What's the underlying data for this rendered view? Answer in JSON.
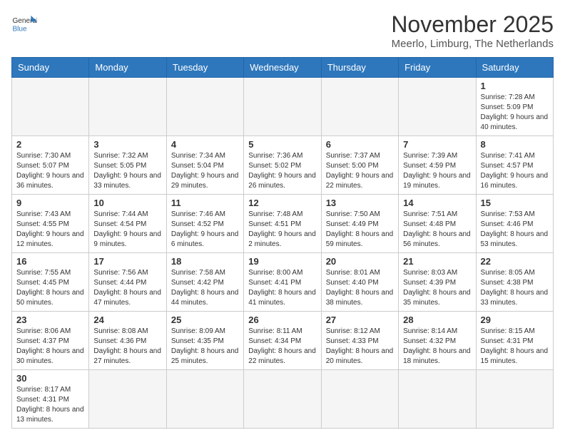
{
  "logo": {
    "text_general": "General",
    "text_blue": "Blue"
  },
  "title": "November 2025",
  "location": "Meerlo, Limburg, The Netherlands",
  "days_of_week": [
    "Sunday",
    "Monday",
    "Tuesday",
    "Wednesday",
    "Thursday",
    "Friday",
    "Saturday"
  ],
  "weeks": [
    [
      {
        "day": null,
        "info": null
      },
      {
        "day": null,
        "info": null
      },
      {
        "day": null,
        "info": null
      },
      {
        "day": null,
        "info": null
      },
      {
        "day": null,
        "info": null
      },
      {
        "day": null,
        "info": null
      },
      {
        "day": "1",
        "info": "Sunrise: 7:28 AM\nSunset: 5:09 PM\nDaylight: 9 hours and 40 minutes."
      }
    ],
    [
      {
        "day": "2",
        "info": "Sunrise: 7:30 AM\nSunset: 5:07 PM\nDaylight: 9 hours and 36 minutes."
      },
      {
        "day": "3",
        "info": "Sunrise: 7:32 AM\nSunset: 5:05 PM\nDaylight: 9 hours and 33 minutes."
      },
      {
        "day": "4",
        "info": "Sunrise: 7:34 AM\nSunset: 5:04 PM\nDaylight: 9 hours and 29 minutes."
      },
      {
        "day": "5",
        "info": "Sunrise: 7:36 AM\nSunset: 5:02 PM\nDaylight: 9 hours and 26 minutes."
      },
      {
        "day": "6",
        "info": "Sunrise: 7:37 AM\nSunset: 5:00 PM\nDaylight: 9 hours and 22 minutes."
      },
      {
        "day": "7",
        "info": "Sunrise: 7:39 AM\nSunset: 4:59 PM\nDaylight: 9 hours and 19 minutes."
      },
      {
        "day": "8",
        "info": "Sunrise: 7:41 AM\nSunset: 4:57 PM\nDaylight: 9 hours and 16 minutes."
      }
    ],
    [
      {
        "day": "9",
        "info": "Sunrise: 7:43 AM\nSunset: 4:55 PM\nDaylight: 9 hours and 12 minutes."
      },
      {
        "day": "10",
        "info": "Sunrise: 7:44 AM\nSunset: 4:54 PM\nDaylight: 9 hours and 9 minutes."
      },
      {
        "day": "11",
        "info": "Sunrise: 7:46 AM\nSunset: 4:52 PM\nDaylight: 9 hours and 6 minutes."
      },
      {
        "day": "12",
        "info": "Sunrise: 7:48 AM\nSunset: 4:51 PM\nDaylight: 9 hours and 2 minutes."
      },
      {
        "day": "13",
        "info": "Sunrise: 7:50 AM\nSunset: 4:49 PM\nDaylight: 8 hours and 59 minutes."
      },
      {
        "day": "14",
        "info": "Sunrise: 7:51 AM\nSunset: 4:48 PM\nDaylight: 8 hours and 56 minutes."
      },
      {
        "day": "15",
        "info": "Sunrise: 7:53 AM\nSunset: 4:46 PM\nDaylight: 8 hours and 53 minutes."
      }
    ],
    [
      {
        "day": "16",
        "info": "Sunrise: 7:55 AM\nSunset: 4:45 PM\nDaylight: 8 hours and 50 minutes."
      },
      {
        "day": "17",
        "info": "Sunrise: 7:56 AM\nSunset: 4:44 PM\nDaylight: 8 hours and 47 minutes."
      },
      {
        "day": "18",
        "info": "Sunrise: 7:58 AM\nSunset: 4:42 PM\nDaylight: 8 hours and 44 minutes."
      },
      {
        "day": "19",
        "info": "Sunrise: 8:00 AM\nSunset: 4:41 PM\nDaylight: 8 hours and 41 minutes."
      },
      {
        "day": "20",
        "info": "Sunrise: 8:01 AM\nSunset: 4:40 PM\nDaylight: 8 hours and 38 minutes."
      },
      {
        "day": "21",
        "info": "Sunrise: 8:03 AM\nSunset: 4:39 PM\nDaylight: 8 hours and 35 minutes."
      },
      {
        "day": "22",
        "info": "Sunrise: 8:05 AM\nSunset: 4:38 PM\nDaylight: 8 hours and 33 minutes."
      }
    ],
    [
      {
        "day": "23",
        "info": "Sunrise: 8:06 AM\nSunset: 4:37 PM\nDaylight: 8 hours and 30 minutes."
      },
      {
        "day": "24",
        "info": "Sunrise: 8:08 AM\nSunset: 4:36 PM\nDaylight: 8 hours and 27 minutes."
      },
      {
        "day": "25",
        "info": "Sunrise: 8:09 AM\nSunset: 4:35 PM\nDaylight: 8 hours and 25 minutes."
      },
      {
        "day": "26",
        "info": "Sunrise: 8:11 AM\nSunset: 4:34 PM\nDaylight: 8 hours and 22 minutes."
      },
      {
        "day": "27",
        "info": "Sunrise: 8:12 AM\nSunset: 4:33 PM\nDaylight: 8 hours and 20 minutes."
      },
      {
        "day": "28",
        "info": "Sunrise: 8:14 AM\nSunset: 4:32 PM\nDaylight: 8 hours and 18 minutes."
      },
      {
        "day": "29",
        "info": "Sunrise: 8:15 AM\nSunset: 4:31 PM\nDaylight: 8 hours and 15 minutes."
      }
    ],
    [
      {
        "day": "30",
        "info": "Sunrise: 8:17 AM\nSunset: 4:31 PM\nDaylight: 8 hours and 13 minutes."
      },
      {
        "day": null,
        "info": null
      },
      {
        "day": null,
        "info": null
      },
      {
        "day": null,
        "info": null
      },
      {
        "day": null,
        "info": null
      },
      {
        "day": null,
        "info": null
      },
      {
        "day": null,
        "info": null
      }
    ]
  ]
}
